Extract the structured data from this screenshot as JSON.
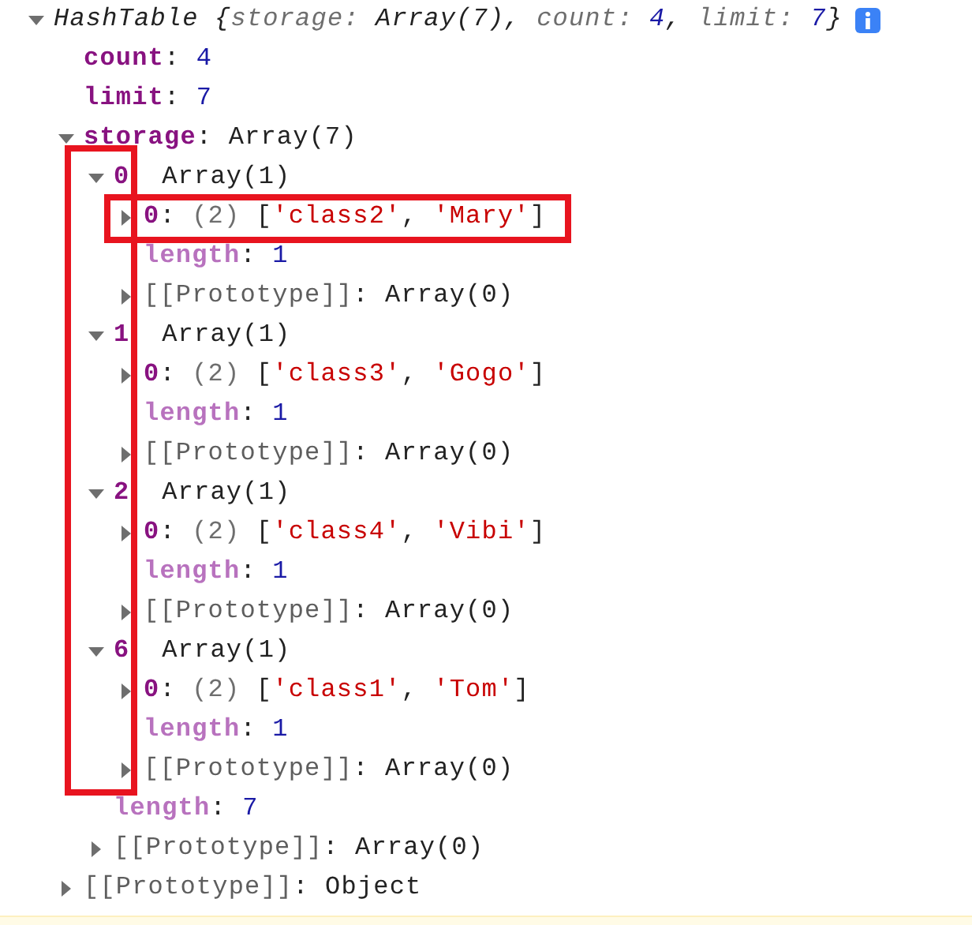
{
  "console": {
    "entries": [
      {
        "kind": "object-preview",
        "expanded": true,
        "info_badge": true,
        "value": [
          {
            "kind": "name",
            "text": "HashTable"
          },
          {
            "kind": "plain",
            "text": " {"
          },
          {
            "kind": "key",
            "text": "storage:"
          },
          {
            "kind": "plain",
            "text": " Array(7), "
          },
          {
            "kind": "key",
            "text": "count:"
          },
          {
            "kind": "number",
            "text": " 4"
          },
          {
            "kind": "plain",
            "text": ", "
          },
          {
            "kind": "key",
            "text": "limit:"
          },
          {
            "kind": "number",
            "text": " 7"
          },
          {
            "kind": "plain",
            "text": "}"
          }
        ],
        "children": [
          {
            "key": "count",
            "kind": "own",
            "separator": ":",
            "value": [
              {
                "kind": "number",
                "text": "4"
              }
            ]
          },
          {
            "key": "limit",
            "kind": "own",
            "separator": ":",
            "value": [
              {
                "kind": "number",
                "text": "7"
              }
            ]
          },
          {
            "key": "storage",
            "kind": "own",
            "separator": ":",
            "expanded": true,
            "keys_highlighted": true,
            "value": [
              {
                "kind": "plain",
                "text": "Array(7)"
              }
            ],
            "children": [
              {
                "key": "0",
                "kind": "own",
                "expanded": true,
                "value": [
                  {
                    "kind": "plain",
                    "text": "Array(1)"
                  }
                ],
                "children": [
                  {
                    "key": "0",
                    "kind": "own",
                    "separator": ":",
                    "expanded": false,
                    "highlighted": true,
                    "value": [
                      {
                        "kind": "muted",
                        "text": "(2)"
                      },
                      {
                        "kind": "plain",
                        "text": " ["
                      },
                      {
                        "kind": "string",
                        "text": "'class2'"
                      },
                      {
                        "kind": "plain",
                        "text": ", "
                      },
                      {
                        "kind": "string",
                        "text": "'Mary'"
                      },
                      {
                        "kind": "plain",
                        "text": "]"
                      }
                    ]
                  },
                  {
                    "key": "length",
                    "kind": "hidden",
                    "separator": ":",
                    "value": [
                      {
                        "kind": "number",
                        "text": "1"
                      }
                    ]
                  },
                  {
                    "key": "[[Prototype]]",
                    "kind": "internal",
                    "separator": ":",
                    "expanded": false,
                    "value": [
                      {
                        "kind": "plain",
                        "text": "Array(0)"
                      }
                    ]
                  }
                ]
              },
              {
                "key": "1",
                "kind": "own",
                "expanded": true,
                "value": [
                  {
                    "kind": "plain",
                    "text": "Array(1)"
                  }
                ],
                "children": [
                  {
                    "key": "0",
                    "kind": "own",
                    "separator": ":",
                    "expanded": false,
                    "value": [
                      {
                        "kind": "muted",
                        "text": "(2)"
                      },
                      {
                        "kind": "plain",
                        "text": " ["
                      },
                      {
                        "kind": "string",
                        "text": "'class3'"
                      },
                      {
                        "kind": "plain",
                        "text": ", "
                      },
                      {
                        "kind": "string",
                        "text": "'Gogo'"
                      },
                      {
                        "kind": "plain",
                        "text": "]"
                      }
                    ]
                  },
                  {
                    "key": "length",
                    "kind": "hidden",
                    "separator": ":",
                    "value": [
                      {
                        "kind": "number",
                        "text": "1"
                      }
                    ]
                  },
                  {
                    "key": "[[Prototype]]",
                    "kind": "internal",
                    "separator": ":",
                    "expanded": false,
                    "value": [
                      {
                        "kind": "plain",
                        "text": "Array(0)"
                      }
                    ]
                  }
                ]
              },
              {
                "key": "2",
                "kind": "own",
                "expanded": true,
                "value": [
                  {
                    "kind": "plain",
                    "text": "Array(1)"
                  }
                ],
                "children": [
                  {
                    "key": "0",
                    "kind": "own",
                    "separator": ":",
                    "expanded": false,
                    "value": [
                      {
                        "kind": "muted",
                        "text": "(2)"
                      },
                      {
                        "kind": "plain",
                        "text": " ["
                      },
                      {
                        "kind": "string",
                        "text": "'class4'"
                      },
                      {
                        "kind": "plain",
                        "text": ", "
                      },
                      {
                        "kind": "string",
                        "text": "'Vibi'"
                      },
                      {
                        "kind": "plain",
                        "text": "]"
                      }
                    ]
                  },
                  {
                    "key": "length",
                    "kind": "hidden",
                    "separator": ":",
                    "value": [
                      {
                        "kind": "number",
                        "text": "1"
                      }
                    ]
                  },
                  {
                    "key": "[[Prototype]]",
                    "kind": "internal",
                    "separator": ":",
                    "expanded": false,
                    "value": [
                      {
                        "kind": "plain",
                        "text": "Array(0)"
                      }
                    ]
                  }
                ]
              },
              {
                "key": "6",
                "kind": "own",
                "expanded": true,
                "value": [
                  {
                    "kind": "plain",
                    "text": "Array(1)"
                  }
                ],
                "children": [
                  {
                    "key": "0",
                    "kind": "own",
                    "separator": ":",
                    "expanded": false,
                    "value": [
                      {
                        "kind": "muted",
                        "text": "(2)"
                      },
                      {
                        "kind": "plain",
                        "text": " ["
                      },
                      {
                        "kind": "string",
                        "text": "'class1'"
                      },
                      {
                        "kind": "plain",
                        "text": ", "
                      },
                      {
                        "kind": "string",
                        "text": "'Tom'"
                      },
                      {
                        "kind": "plain",
                        "text": "]"
                      }
                    ]
                  },
                  {
                    "key": "length",
                    "kind": "hidden",
                    "separator": ":",
                    "value": [
                      {
                        "kind": "number",
                        "text": "1"
                      }
                    ]
                  },
                  {
                    "key": "[[Prototype]]",
                    "kind": "internal",
                    "separator": ":",
                    "expanded": false,
                    "value": [
                      {
                        "kind": "plain",
                        "text": "Array(0)"
                      }
                    ]
                  }
                ]
              },
              {
                "key": "length",
                "kind": "hidden",
                "separator": ":",
                "value": [
                  {
                    "kind": "number",
                    "text": "7"
                  }
                ]
              },
              {
                "key": "[[Prototype]]",
                "kind": "internal",
                "separator": ":",
                "expanded": false,
                "value": [
                  {
                    "kind": "plain",
                    "text": "Array(0)"
                  }
                ]
              }
            ]
          },
          {
            "key": "[[Prototype]]",
            "kind": "internal",
            "separator": ":",
            "expanded": false,
            "value": [
              {
                "kind": "plain",
                "text": "Object"
              }
            ]
          }
        ]
      }
    ]
  }
}
